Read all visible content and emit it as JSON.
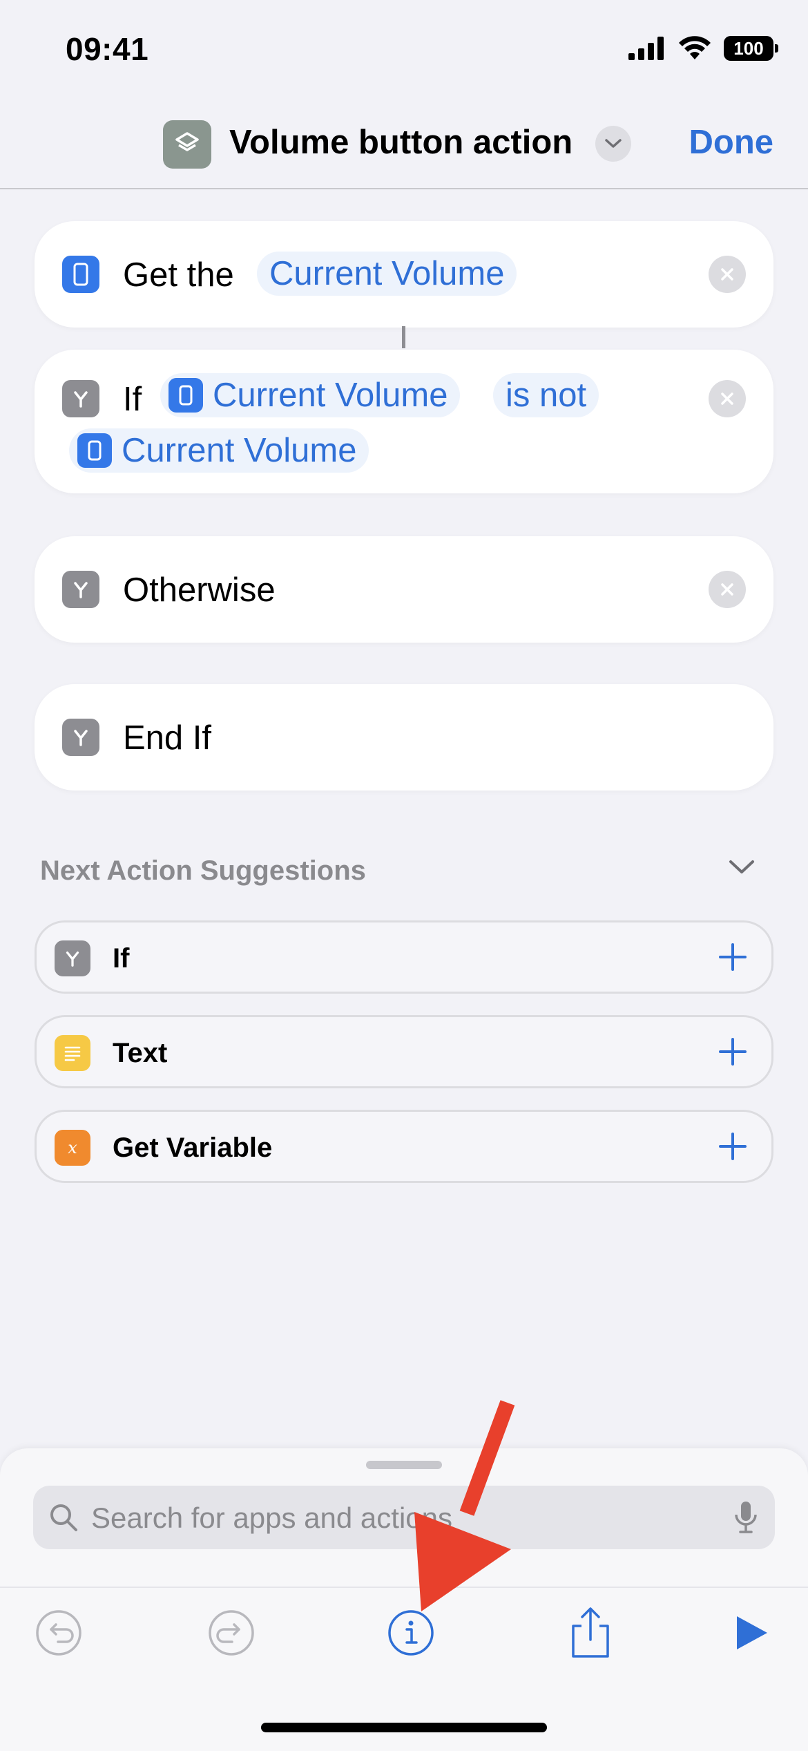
{
  "status": {
    "time": "09:41",
    "battery": "100"
  },
  "nav": {
    "title": "Volume button action",
    "done_label": "Done"
  },
  "actions": {
    "get": {
      "prefix": "Get the",
      "token": "Current Volume"
    },
    "if": {
      "label": "If",
      "token1": "Current Volume",
      "operator": "is not",
      "token2": "Current Volume"
    },
    "otherwise": {
      "label": "Otherwise"
    },
    "endif": {
      "label": "End If"
    }
  },
  "suggestions": {
    "header": "Next Action Suggestions",
    "items": [
      {
        "label": "If",
        "icon": "branch-icon",
        "color": "#8d8d92"
      },
      {
        "label": "Text",
        "icon": "text-lines-icon",
        "color": "#f6c945"
      },
      {
        "label": "Get Variable",
        "icon": "variable-icon",
        "color": "#f08a2e"
      }
    ]
  },
  "search": {
    "placeholder": "Search for apps and actions"
  },
  "colors": {
    "accent": "#2f6fd6",
    "annotation_arrow": "#e8402c"
  }
}
